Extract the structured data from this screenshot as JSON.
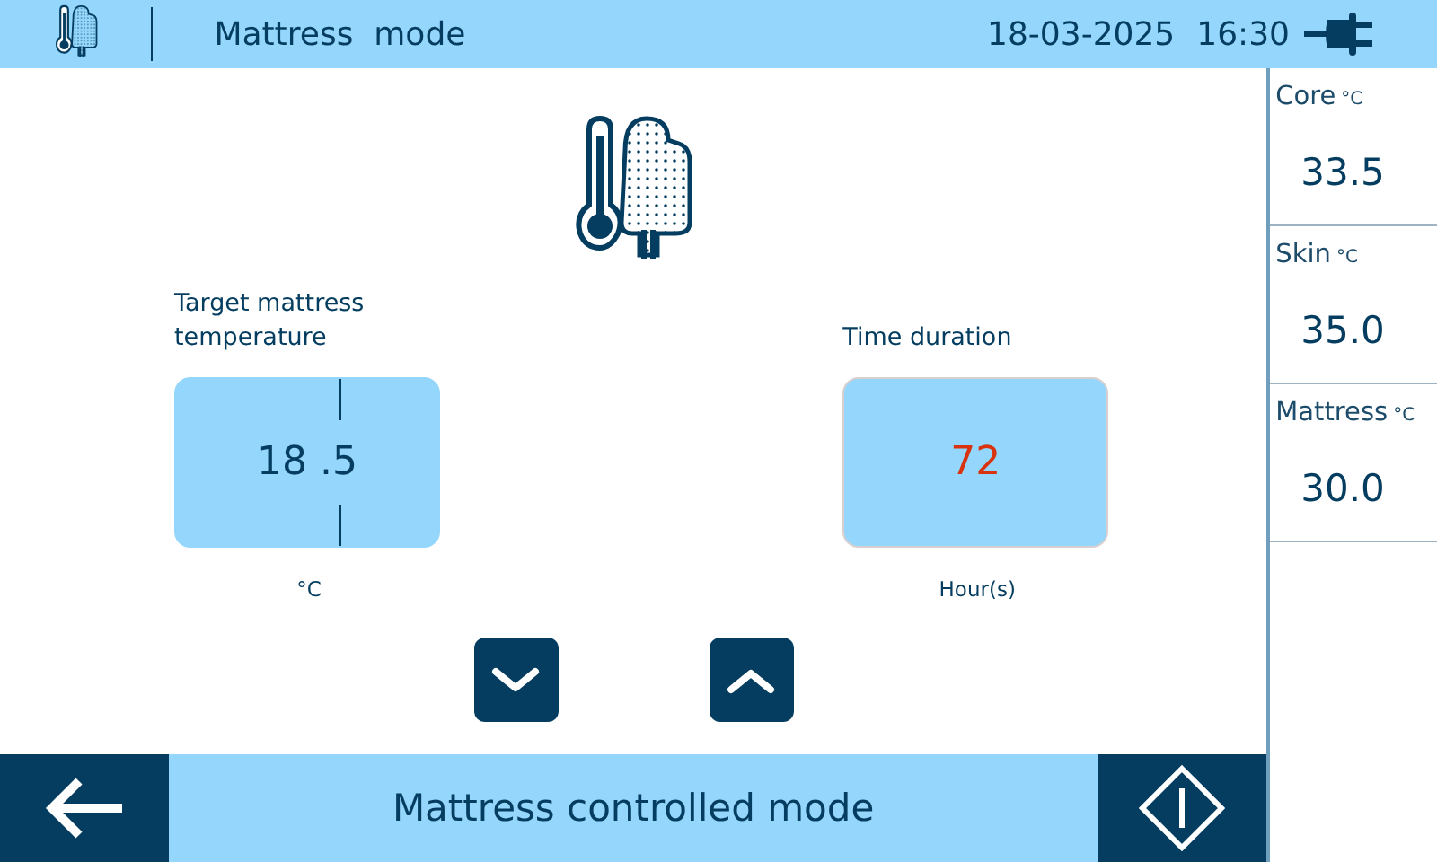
{
  "header": {
    "title": "Mattress  mode",
    "date": "18-03-2025",
    "time": "16:30"
  },
  "settings": [
    {
      "label": "Target mattress temperature",
      "value": "18 .5",
      "unit": "°C",
      "kind": "split",
      "alert": false
    },
    {
      "label": "Time duration",
      "value": "72",
      "unit": "Hour(s)",
      "kind": "plain",
      "alert": true
    }
  ],
  "readings": [
    {
      "name": "Core",
      "unit": "°C",
      "value": "33.5"
    },
    {
      "name": "Skin",
      "unit": "°C",
      "value": "35.0"
    },
    {
      "name": "Mattress",
      "unit": "°C",
      "value": "30.0"
    }
  ],
  "footer": {
    "title": "Mattress controlled mode"
  }
}
